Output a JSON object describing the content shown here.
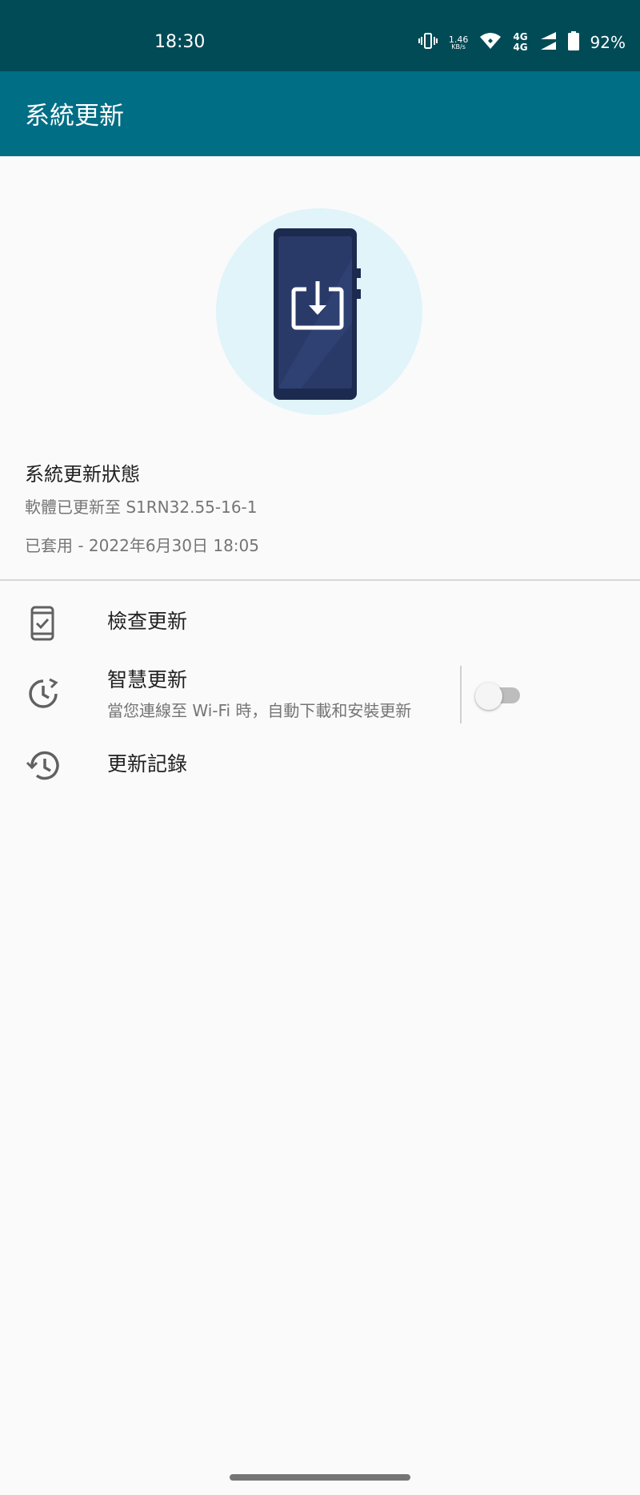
{
  "status_bar": {
    "time": "18:30",
    "data_speed_value": "1.46",
    "data_speed_unit": "KB/s",
    "network_1": "4G",
    "network_2": "4G",
    "battery": "92%"
  },
  "app_bar": {
    "title": "系統更新"
  },
  "status": {
    "title": "系統更新狀態",
    "software": "軟體已更新至 S1RN32.55-16-1",
    "applied": "已套用 - 2022年6月30日 18:05"
  },
  "menu": {
    "check_update": "檢查更新",
    "smart_update": "智慧更新",
    "smart_update_desc": "當您連線至 Wi-Fi 時，自動下載和安裝更新",
    "smart_update_enabled": false,
    "update_history": "更新記錄"
  },
  "colors": {
    "status_bar": "#004b56",
    "app_bar": "#006e85",
    "hero_circle": "#e0f4fa",
    "phone_body": "#1c2a4f",
    "phone_screen": "#2a3a68"
  }
}
